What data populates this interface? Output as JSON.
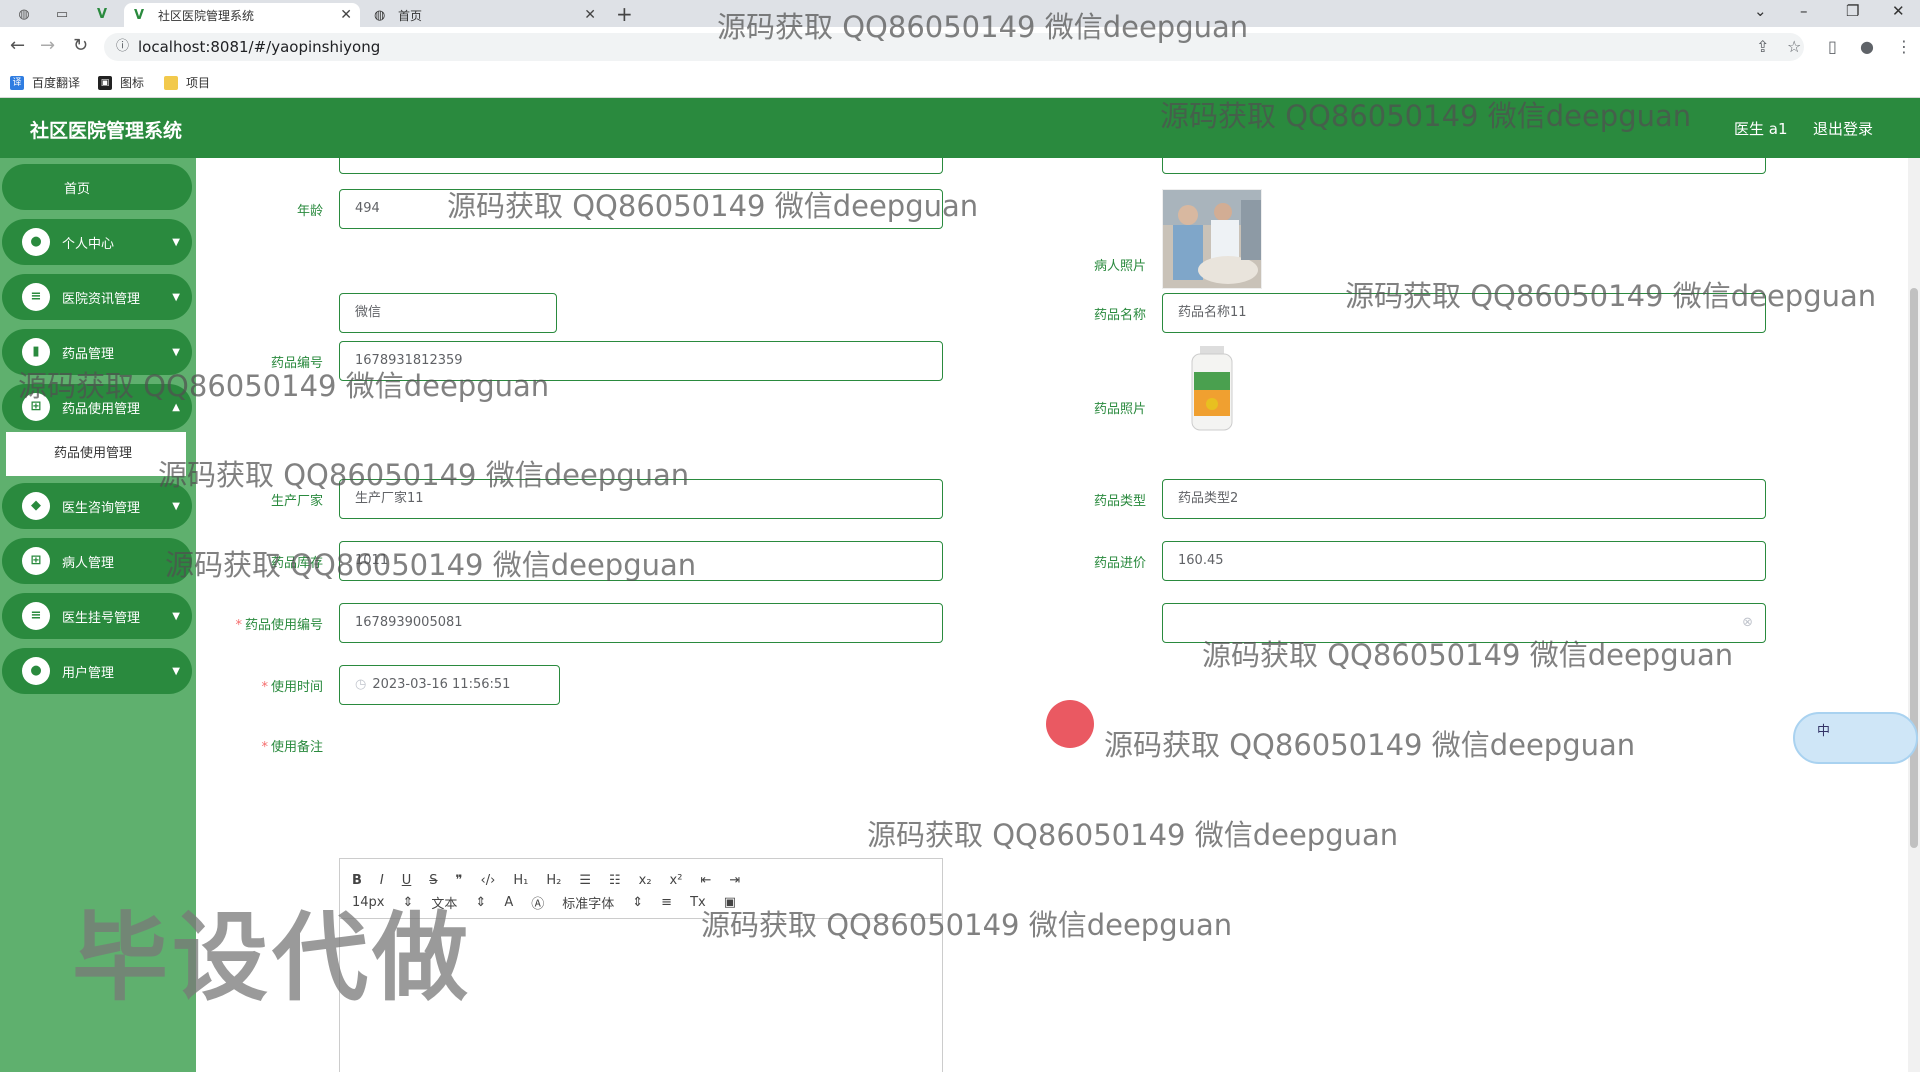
{
  "browser": {
    "tabs": [
      {
        "title": "社区医院管理系统",
        "active": true
      },
      {
        "title": "首页",
        "active": false
      }
    ],
    "url": "localhost:8081/#/yaopinshiyong",
    "bookmarks": [
      "百度翻译",
      "图标",
      "项目"
    ]
  },
  "header": {
    "title": "社区医院管理系统",
    "user": "医生 a1",
    "logout": "退出登录"
  },
  "sidebar": {
    "items": [
      {
        "label": "首页",
        "icon": "home-icon"
      },
      {
        "label": "个人中心",
        "icon": "user-icon"
      },
      {
        "label": "医院资讯管理",
        "icon": "list-icon"
      },
      {
        "label": "药品管理",
        "icon": "chart-icon"
      },
      {
        "label": "药品使用管理",
        "icon": "grid-icon"
      },
      {
        "label": "医生咨询管理",
        "icon": "chat-icon"
      },
      {
        "label": "病人管理",
        "icon": "grid-icon"
      },
      {
        "label": "医生挂号管理",
        "icon": "list-icon"
      },
      {
        "label": "用户管理",
        "icon": "user-icon"
      }
    ],
    "submenu": "药品使用管理"
  },
  "form": {
    "age_label": "年龄",
    "age": "494",
    "patient_photo_label": "病人照片",
    "drug_name_label": "药品名称",
    "drug_name": "药品名称11",
    "drug_code_label": "药品编号",
    "drug_code": "1678931812359",
    "drug_photo_label": "药品照片",
    "manufacturer_label": "生产厂家",
    "manufacturer": "生产厂家11",
    "drug_type_label": "药品类型",
    "drug_type": "药品类型2",
    "stock_label": "药品库存",
    "stock": "1011",
    "price_label": "药品进价",
    "price": "160.45",
    "usage_code_label": "药品使用编号",
    "usage_code": "1678939005081",
    "usage_time_label": "使用时间",
    "usage_time": "2023-03-16 11:56:51",
    "usage_note_label": "使用备注",
    "left_partial_value": "微信"
  },
  "editor": {
    "font_size": "14px",
    "text_type": "文本",
    "font_family": "标准字体"
  },
  "watermarks": {
    "line": "源码获取 QQ86050149 微信deepguan",
    "big": "毕设代做"
  },
  "ime": "中",
  "colors": {
    "primary": "#2a8a3e",
    "sidebar_bg": "#5fb06e",
    "submenu_bg": "#ffffff"
  }
}
